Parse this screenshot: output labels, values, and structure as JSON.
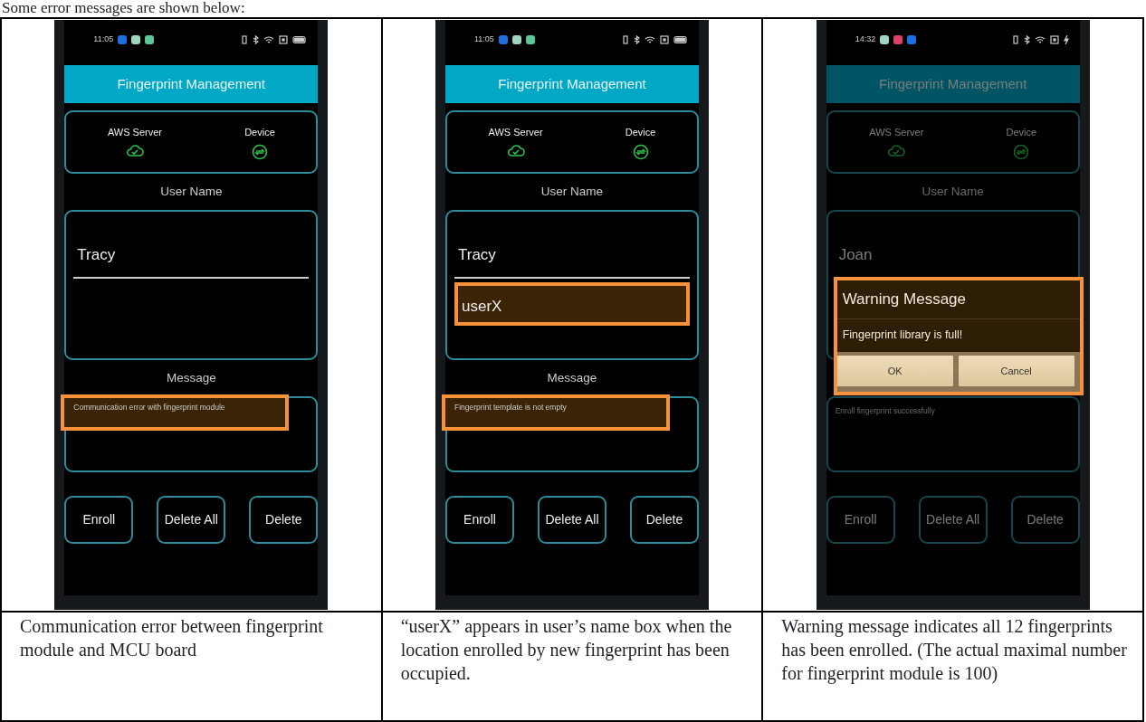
{
  "heading": "Some error messages are shown below:",
  "panels": [
    {
      "screen": {
        "dimmed": false,
        "status_bar": {
          "time": "11:05",
          "notification_icons": [
            {
              "color": "#1e6fe0"
            },
            {
              "color": "#9fd6c0"
            },
            {
              "color": "#5cc89a"
            }
          ],
          "charging": false
        },
        "title": "Fingerprint Management",
        "connections": [
          {
            "label": "AWS Server",
            "kind": "cloud"
          },
          {
            "label": "Device",
            "kind": "sync"
          }
        ],
        "user_name_label": "User Name",
        "names": [
          {
            "value": "Tracy",
            "highlighted": false
          }
        ],
        "message_label": "Message",
        "message": {
          "text": "Communication error with fingerprint module",
          "highlighted": true
        },
        "buttons": [
          "Enroll",
          "Delete All",
          "Delete"
        ]
      },
      "caption": "Communication error between fingerprint module and MCU board"
    },
    {
      "screen": {
        "dimmed": false,
        "status_bar": {
          "time": "11:05",
          "notification_icons": [
            {
              "color": "#1e6fe0"
            },
            {
              "color": "#9fd6c0"
            },
            {
              "color": "#5cc89a"
            }
          ],
          "charging": false
        },
        "title": "Fingerprint Management",
        "connections": [
          {
            "label": "AWS Server",
            "kind": "cloud"
          },
          {
            "label": "Device",
            "kind": "sync"
          }
        ],
        "user_name_label": "User Name",
        "names": [
          {
            "value": "Tracy",
            "highlighted": false
          },
          {
            "value": "userX",
            "highlighted": true
          }
        ],
        "message_label": "Message",
        "message": {
          "text": "Fingerprint template is not empty",
          "highlighted": true
        },
        "buttons": [
          "Enroll",
          "Delete All",
          "Delete"
        ]
      },
      "caption": "“userX” appears in user’s name box when the location enrolled by new fingerprint has been occupied."
    },
    {
      "screen": {
        "dimmed": true,
        "status_bar": {
          "time": "14:32",
          "notification_icons": [
            {
              "color": "#9fd6c0"
            },
            {
              "color": "#e0406a"
            },
            {
              "color": "#1e6fe0"
            }
          ],
          "charging": true
        },
        "title": "Fingerprint Management",
        "connections": [
          {
            "label": "AWS Server",
            "kind": "cloud"
          },
          {
            "label": "Device",
            "kind": "sync"
          }
        ],
        "user_name_label": "User Name",
        "names": [
          {
            "value": "Joan",
            "highlighted": false
          }
        ],
        "message": {
          "text": "Enroll fingerprint successfully",
          "highlighted": false
        },
        "buttons": [
          "Enroll",
          "Delete All",
          "Delete"
        ],
        "dialog": {
          "title": "Warning Message",
          "text": "Fingerprint library is full!",
          "buttons": [
            "OK",
            "Cancel"
          ],
          "highlighted": true
        }
      },
      "caption": "Warning message indicates all 12 fingerprints has been enrolled. (The actual maximal number for fingerprint module is 100)"
    }
  ]
}
